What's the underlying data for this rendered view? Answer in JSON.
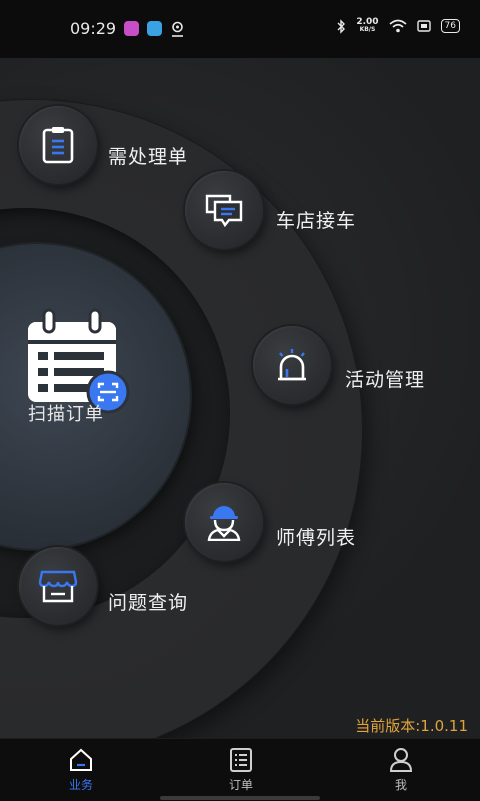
{
  "status_bar": {
    "time": "09:29",
    "net_speed_value": "2.00",
    "net_speed_unit": "KB/S",
    "battery": "76"
  },
  "center": {
    "scan_label": "扫描订单",
    "icon": "calendar-list-scan-icon"
  },
  "menu": {
    "items": [
      {
        "label": "需处理单",
        "icon": "clipboard-icon"
      },
      {
        "label": "车店接车",
        "icon": "chat-bubbles-icon"
      },
      {
        "label": "活动管理",
        "icon": "alarm-light-icon"
      },
      {
        "label": "师傅列表",
        "icon": "worker-icon"
      },
      {
        "label": "问题查询",
        "icon": "storefront-icon"
      }
    ]
  },
  "version": "当前版本:1.0.11",
  "tabs": [
    {
      "label": "业务",
      "icon": "home-icon",
      "active": true
    },
    {
      "label": "订单",
      "icon": "list-icon",
      "active": false
    },
    {
      "label": "我",
      "icon": "person-icon",
      "active": false
    }
  ],
  "colors": {
    "accent": "#3a78f2",
    "version": "#e0a43b",
    "background": "#232425"
  }
}
